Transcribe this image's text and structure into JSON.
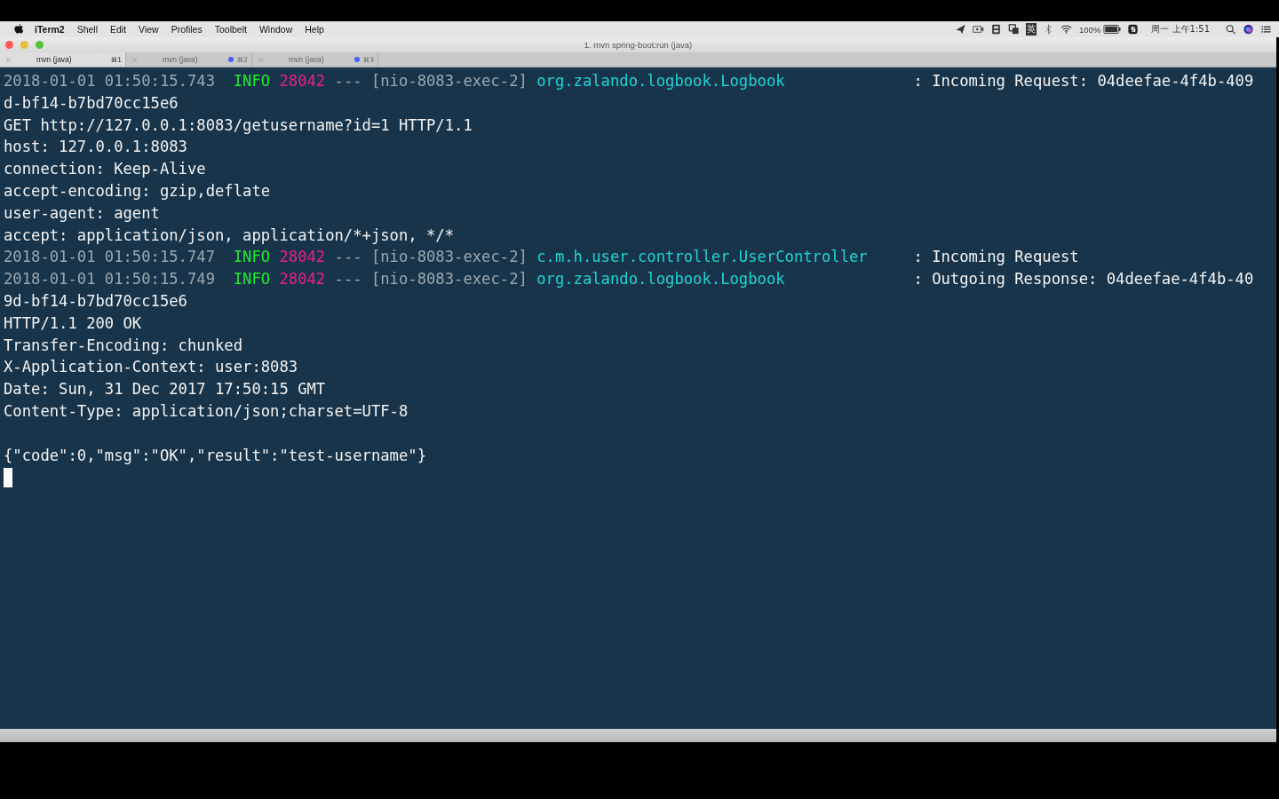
{
  "menu_bar": {
    "app": "iTerm2",
    "items": [
      "Shell",
      "Edit",
      "View",
      "Profiles",
      "Toolbelt",
      "Window",
      "Help"
    ],
    "ime": "英",
    "battery": "100%",
    "clock": "周一 上午1:51"
  },
  "window": {
    "title": "1. mvn spring-boot:run (java)"
  },
  "tabs": [
    {
      "label": "mvn (java)",
      "shortcut": "⌘1",
      "selected": true,
      "activity": false
    },
    {
      "label": "mvn (java)",
      "shortcut": "⌘2",
      "selected": false,
      "activity": true
    },
    {
      "label": "mvn (java)",
      "shortcut": "⌘3",
      "selected": false,
      "activity": true
    }
  ],
  "terminal": {
    "lines": [
      [
        {
          "kind": "time",
          "text": "2018-01-01 01:50:15.743"
        },
        {
          "kind": "level",
          "text": "INFO"
        },
        {
          "kind": "pid",
          "text": "28042"
        },
        {
          "kind": "thread",
          "text": "--- [nio-8083-exec-2]"
        },
        {
          "kind": "logger",
          "text": "org.zalando.logbook.Logbook"
        },
        {
          "kind": "text",
          "text": ": Incoming Request: 04deefae-4f4b-409"
        }
      ],
      [
        {
          "kind": "text",
          "text": "d-bf14-b7bd70cc15e6"
        }
      ],
      [
        {
          "kind": "text",
          "text": "GET http://127.0.0.1:8083/getusername?id=1 HTTP/1.1"
        }
      ],
      [
        {
          "kind": "text",
          "text": "host: 127.0.0.1:8083"
        }
      ],
      [
        {
          "kind": "text",
          "text": "connection: Keep-Alive"
        }
      ],
      [
        {
          "kind": "text",
          "text": "accept-encoding: gzip,deflate"
        }
      ],
      [
        {
          "kind": "text",
          "text": "user-agent: agent"
        }
      ],
      [
        {
          "kind": "text",
          "text": "accept: application/json, application/*+json, */*"
        }
      ],
      [
        {
          "kind": "time",
          "text": "2018-01-01 01:50:15.747"
        },
        {
          "kind": "level",
          "text": "INFO"
        },
        {
          "kind": "pid",
          "text": "28042"
        },
        {
          "kind": "thread",
          "text": "--- [nio-8083-exec-2]"
        },
        {
          "kind": "logger",
          "text": "c.m.h.user.controller.UserController"
        },
        {
          "kind": "text",
          "text": ": Incoming Request"
        }
      ],
      [
        {
          "kind": "time",
          "text": "2018-01-01 01:50:15.749"
        },
        {
          "kind": "level",
          "text": "INFO"
        },
        {
          "kind": "pid",
          "text": "28042"
        },
        {
          "kind": "thread",
          "text": "--- [nio-8083-exec-2]"
        },
        {
          "kind": "logger",
          "text": "org.zalando.logbook.Logbook"
        },
        {
          "kind": "text",
          "text": ": Outgoing Response: 04deefae-4f4b-40"
        }
      ],
      [
        {
          "kind": "text",
          "text": "9d-bf14-b7bd70cc15e6"
        }
      ],
      [
        {
          "kind": "text",
          "text": "HTTP/1.1 200 OK"
        }
      ],
      [
        {
          "kind": "text",
          "text": "Transfer-Encoding: chunked"
        }
      ],
      [
        {
          "kind": "text",
          "text": "X-Application-Context: user:8083"
        }
      ],
      [
        {
          "kind": "text",
          "text": "Date: Sun, 31 Dec 2017 17:50:15 GMT"
        }
      ],
      [
        {
          "kind": "text",
          "text": "Content-Type: application/json;charset=UTF-8"
        }
      ],
      [
        {
          "kind": "text",
          "blank_before": true,
          "text": "{\"code\":0,\"msg\":\"OK\",\"result\":\"test-username\"}"
        }
      ]
    ]
  }
}
